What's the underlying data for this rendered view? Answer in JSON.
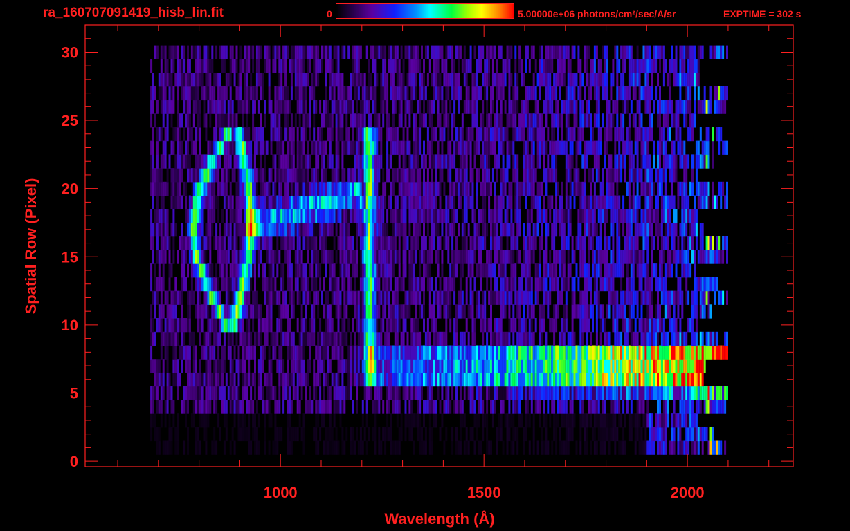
{
  "header": {
    "filename": "ra_160707091419_hisb_lin.fit",
    "colorbar_min": "0",
    "colorbar_max_label": "5.00000e+06 photons/cm²/sec/A/sr",
    "exptime": "EXPTIME = 302 s"
  },
  "colors": {
    "axes": "#ff2020",
    "background": "#000000"
  },
  "chart_data": {
    "type": "heatmap",
    "xlabel": "Wavelength (Å)",
    "ylabel": "Spatial Row (Pixel)",
    "xlim": [
      520,
      2260
    ],
    "ylim": [
      -0.4,
      32
    ],
    "x_ticks": [
      "1000",
      "1500",
      "2000"
    ],
    "x_tick_values": [
      1000,
      1500,
      2000
    ],
    "y_ticks": [
      "0",
      "5",
      "10",
      "15",
      "20",
      "25",
      "30"
    ],
    "y_tick_values": [
      0,
      5,
      10,
      15,
      20,
      25,
      30
    ],
    "colorbar": {
      "min": 0,
      "max": 5000000,
      "units": "photons/cm²/sec/A/sr"
    },
    "features": [
      {
        "name": "ring emission",
        "x_range": [
          790,
          945
        ],
        "rows": [
          10,
          24
        ]
      },
      {
        "name": "Lyman-alpha line",
        "wavelength": 1216,
        "rows": [
          6,
          24
        ]
      },
      {
        "name": "continuum band",
        "x_range": [
          1216,
          2080
        ],
        "rows": [
          6,
          9
        ]
      }
    ]
  }
}
